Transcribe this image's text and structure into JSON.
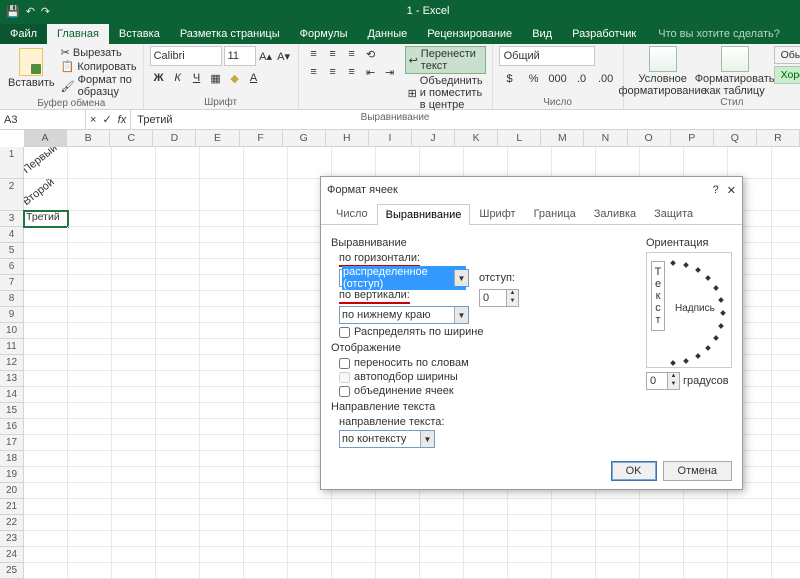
{
  "title": "1 - Excel",
  "menu": {
    "file": "Файл",
    "home": "Главная",
    "insert": "Вставка",
    "layout": "Разметка страницы",
    "formulas": "Формулы",
    "data": "Данные",
    "review": "Рецензирование",
    "view": "Вид",
    "developer": "Разработчик",
    "tell": "Что вы хотите сделать?"
  },
  "ribbon": {
    "clipboard": {
      "paste": "Вставить",
      "cut": "Вырезать",
      "copy": "Копировать",
      "format": "Формат по образцу",
      "label": "Буфер обмена"
    },
    "font": {
      "name": "Calibri",
      "size": "11",
      "label": "Шрифт"
    },
    "align": {
      "wrap": "Перенести текст",
      "merge": "Объединить и поместить в центре",
      "label": "Выравнивание"
    },
    "number": {
      "format": "Общий",
      "label": "Число"
    },
    "styles": {
      "cond": "Условное форматирование",
      "table": "Форматировать как таблицу",
      "normal": "Обычный",
      "good": "Хороший",
      "label": "Стил"
    }
  },
  "namebox": "A3",
  "formula": "Третий",
  "cols": [
    "A",
    "B",
    "C",
    "D",
    "E",
    "F",
    "G",
    "H",
    "I",
    "J",
    "K",
    "L",
    "M",
    "N",
    "O",
    "P",
    "Q",
    "R"
  ],
  "cells": {
    "a1": "Первый",
    "a2": "Второй",
    "a3": "Третий"
  },
  "dialog": {
    "title": "Формат ячеек",
    "help": "?",
    "tabs": {
      "number": "Число",
      "align": "Выравнивание",
      "font": "Шрифт",
      "border": "Граница",
      "fill": "Заливка",
      "protect": "Защита"
    },
    "sect_align": "Выравнивание",
    "lbl_h": "по горизонтали:",
    "val_h": "распределенное (отступ)",
    "lbl_indent": "отступ:",
    "val_indent": "0",
    "lbl_v": "по вертикали:",
    "val_v": "по нижнему краю",
    "chk_dist": "Распределять по ширине",
    "sect_disp": "Отображение",
    "chk_wrap": "переносить по словам",
    "chk_auto": "автоподбор ширины",
    "chk_merge": "объединение ячеек",
    "sect_dir": "Направление текста",
    "lbl_dir": "направление текста:",
    "val_dir": "по контексту",
    "sect_orient": "Ориентация",
    "orient_v": "Текст",
    "orient_h": "Надпись",
    "deg_val": "0",
    "deg_lbl": "градусов",
    "ok": "OK",
    "cancel": "Отмена"
  }
}
